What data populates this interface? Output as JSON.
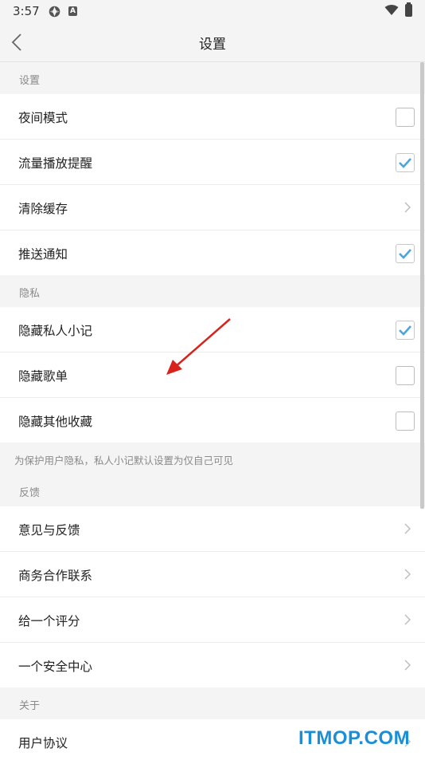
{
  "status": {
    "time": "3:57",
    "badge_letter": "A"
  },
  "nav": {
    "title": "设置"
  },
  "sections": [
    {
      "header": "设置",
      "rows": [
        {
          "label": "夜间模式",
          "control": "checkbox",
          "checked": false
        },
        {
          "label": "流量播放提醒",
          "control": "checkbox",
          "checked": true
        },
        {
          "label": "清除缓存",
          "control": "chevron"
        },
        {
          "label": "推送通知",
          "control": "checkbox",
          "checked": true
        }
      ]
    },
    {
      "header": "隐私",
      "rows": [
        {
          "label": "隐藏私人小记",
          "control": "checkbox",
          "checked": true
        },
        {
          "label": "隐藏歌单",
          "control": "checkbox",
          "checked": false
        },
        {
          "label": "隐藏其他收藏",
          "control": "checkbox",
          "checked": false
        }
      ],
      "note": "为保护用户隐私，私人小记默认设置为仅自己可见"
    },
    {
      "header": "反馈",
      "rows": [
        {
          "label": "意见与反馈",
          "control": "chevron"
        },
        {
          "label": "商务合作联系",
          "control": "chevron"
        },
        {
          "label": "给一个评分",
          "control": "chevron"
        },
        {
          "label": "一个安全中心",
          "control": "chevron"
        }
      ]
    },
    {
      "header": "关于",
      "rows": [
        {
          "label": "用户协议",
          "control": "chevron"
        }
      ]
    }
  ],
  "watermark": "ITMOP.COM",
  "colors": {
    "check": "#4ba6df",
    "watermark": "#1a8fd8",
    "annotation_arrow": "#d9221c"
  }
}
